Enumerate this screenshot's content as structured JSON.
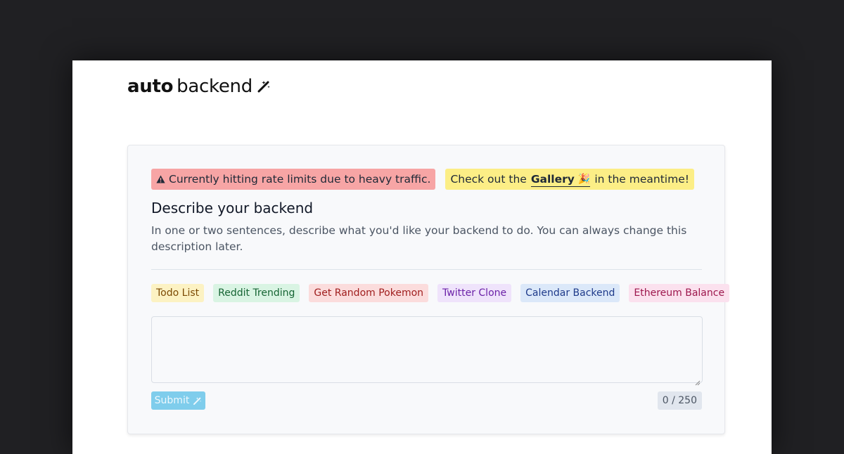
{
  "logo": {
    "bold": "auto",
    "light": "backend",
    "icon": "magic-wand-icon"
  },
  "alerts": {
    "rate_limit": "Currently hitting rate limits due to heavy traffic.",
    "gallery_prefix": "Check out the",
    "gallery_link": "Gallery",
    "gallery_suffix": "in the meantime!",
    "party_icon": "🎉"
  },
  "form": {
    "title": "Describe your backend",
    "description": "In one or two sentences, describe what you'd like your backend to do. You can always change this description later.",
    "examples": [
      {
        "label": "Todo List",
        "color": "#fcf2c3"
      },
      {
        "label": "Reddit Trending",
        "color": "#d9f4e3"
      },
      {
        "label": "Get Random Pokemon",
        "color": "#fbdcdc"
      },
      {
        "label": "Twitter Clone",
        "color": "#efe3fb"
      },
      {
        "label": "Calendar Backend",
        "color": "#dbe8f9"
      },
      {
        "label": "Ethereum Balance",
        "color": "#fbe1ee"
      }
    ],
    "input_value": "",
    "submit_label": "Submit",
    "counter": "0 / 250"
  },
  "colors": {
    "backdrop": "#202023",
    "alert_red": "#f7a5a5",
    "alert_yellow": "#fcee86",
    "submit": "#7fcdec"
  }
}
